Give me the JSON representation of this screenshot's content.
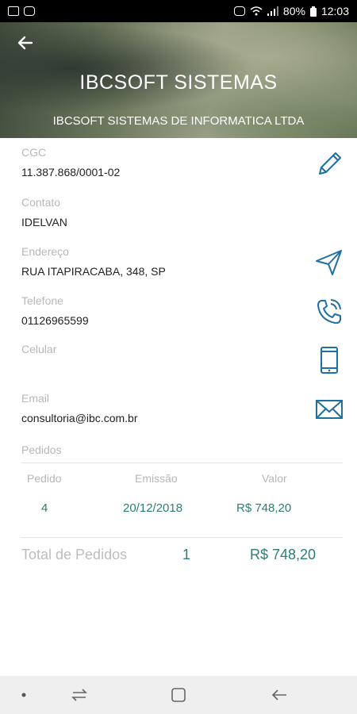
{
  "status_bar": {
    "battery": "80%",
    "time": "12:03"
  },
  "header": {
    "title": "IBCSOFT SISTEMAS",
    "subtitle": "IBCSOFT SISTEMAS DE INFORMATICA LTDA"
  },
  "fields": {
    "cgc": {
      "label": "CGC",
      "value": "11.387.868/0001-02"
    },
    "contato": {
      "label": "Contato",
      "value": "IDELVAN"
    },
    "endereco": {
      "label": "Endereço",
      "value": "RUA ITAPIRACABA, 348, SP"
    },
    "telefone": {
      "label": "Telefone",
      "value": "01126965599"
    },
    "celular": {
      "label": "Celular",
      "value": ""
    },
    "email": {
      "label": "Email",
      "value": "consultoria@ibc.com.br"
    }
  },
  "pedidos": {
    "label": "Pedidos",
    "columns": [
      "Pedido",
      "Emissão",
      "Valor"
    ],
    "rows": [
      {
        "pedido": "4",
        "emissao": "20/12/2018",
        "valor": "R$ 748,20"
      }
    ],
    "total_label": "Total de Pedidos",
    "total_count": "1",
    "total_value": "R$ 748,20"
  },
  "colors": {
    "accent": "#1f6fa3",
    "teal": "#2a7f73",
    "muted": "#b7b7b7"
  },
  "icons": {
    "back": "arrow-left-icon",
    "edit": "pencil-icon",
    "navigate": "send-icon",
    "call": "phone-icon",
    "mobile": "mobile-phone-icon",
    "email": "envelope-icon"
  }
}
